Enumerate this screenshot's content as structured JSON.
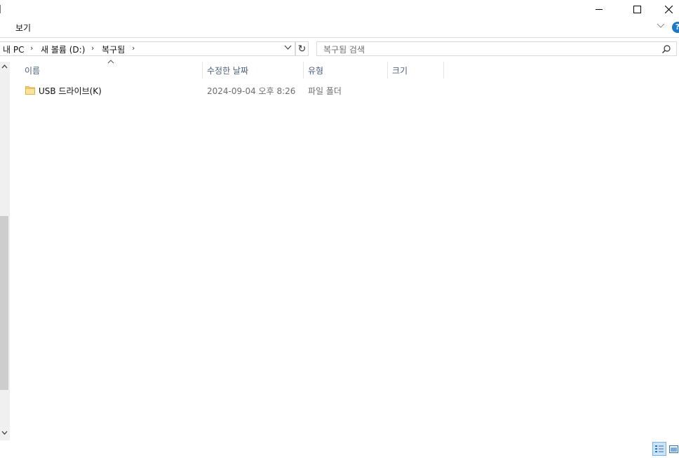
{
  "window": {
    "minimize_icon": "minimize-icon",
    "maximize_icon": "maximize-icon",
    "close_icon": "close-icon"
  },
  "ribbon": {
    "tab_view": "보기",
    "help": "?"
  },
  "address": {
    "crumbs": [
      "내 PC",
      "새 볼륨 (D:)",
      "복구됨"
    ],
    "separator": "›",
    "refresh": "↻"
  },
  "search": {
    "placeholder": "복구됨 검색"
  },
  "columns": {
    "name": "이름",
    "date": "수정한 날짜",
    "type": "유형",
    "size": "크기"
  },
  "rows": [
    {
      "name": "USB 드라이브(K)",
      "date": "2024-09-04 오후 8:26",
      "type": "파일 폴더",
      "size": ""
    }
  ],
  "colors": {
    "accent": "#1979ca",
    "folder": "#f8d775",
    "header_text": "#4c607a"
  }
}
